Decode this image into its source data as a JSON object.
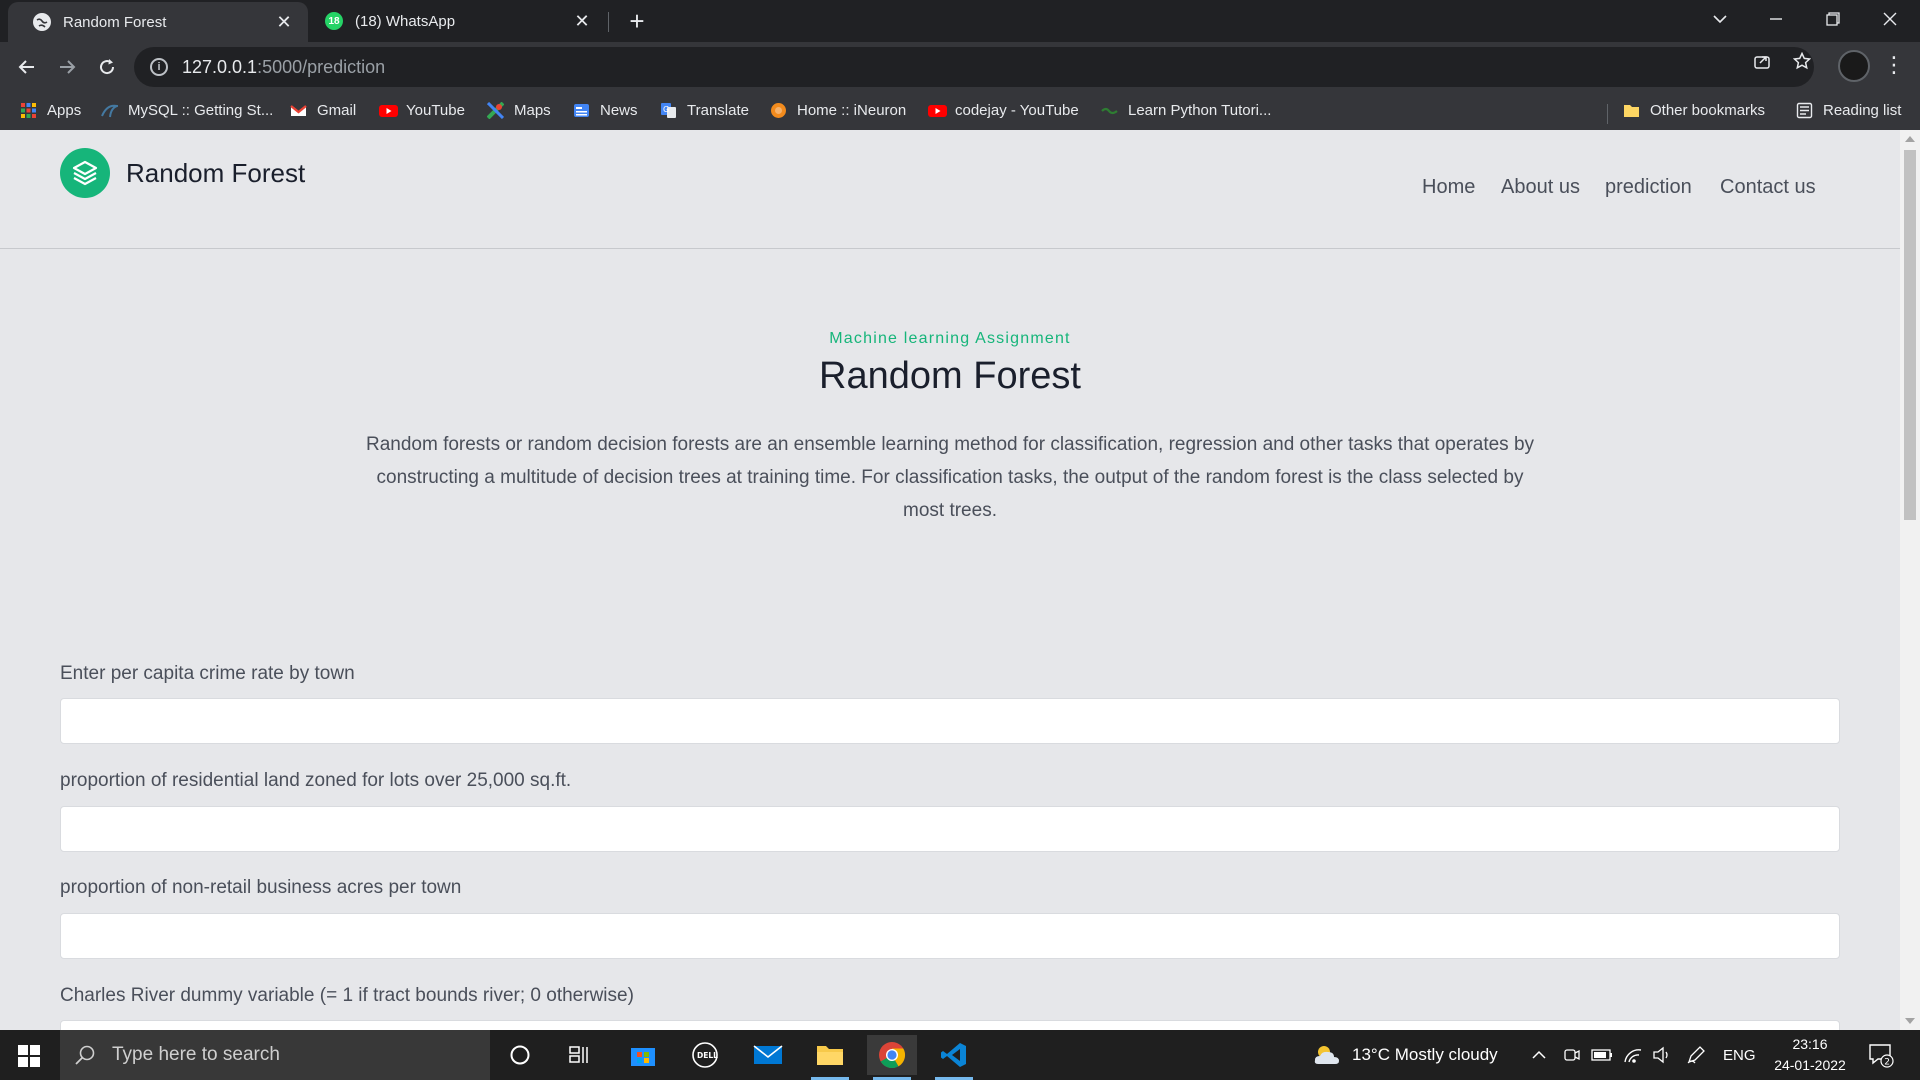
{
  "browser": {
    "tabs": [
      {
        "title": "Random Forest",
        "active": true
      },
      {
        "title": "(18) WhatsApp",
        "active": false,
        "badge": "18"
      }
    ],
    "address": {
      "host": "127.0.0.1",
      "path": ":5000/prediction"
    },
    "bookmarks": [
      {
        "label": "Apps",
        "icon": "apps-grid-icon"
      },
      {
        "label": "MySQL :: Getting St...",
        "icon": "mysql-icon"
      },
      {
        "label": "Gmail",
        "icon": "gmail-icon"
      },
      {
        "label": "YouTube",
        "icon": "youtube-icon"
      },
      {
        "label": "Maps",
        "icon": "maps-icon"
      },
      {
        "label": "News",
        "icon": "news-icon"
      },
      {
        "label": "Translate",
        "icon": "translate-icon"
      },
      {
        "label": "Home :: iNeuron",
        "icon": "ineuron-icon"
      },
      {
        "label": "codejay - YouTube",
        "icon": "youtube-icon"
      },
      {
        "label": "Learn Python Tutori...",
        "icon": "python-icon"
      }
    ],
    "other_bookmarks": "Other bookmarks",
    "reading_list": "Reading list"
  },
  "site": {
    "brand": "Random Forest",
    "nav": [
      "Home",
      "About us",
      "prediction",
      "Contact us"
    ],
    "hero": {
      "subtitle": "Machine learning Assignment",
      "title": "Random Forest",
      "description": "Random forests or random decision forests are an ensemble learning method for classification, regression and other tasks that operates by constructing a multitude of decision trees at training time. For classification tasks, the output of the random forest is the class selected by most trees."
    },
    "form": {
      "fields": [
        {
          "label": "Enter per capita crime rate by town",
          "value": ""
        },
        {
          "label": "proportion of residential land zoned for lots over 25,000 sq.ft.",
          "value": ""
        },
        {
          "label": "proportion of non-retail business acres per town",
          "value": ""
        },
        {
          "label": "Charles River dummy variable (= 1 if tract bounds river; 0 otherwise)",
          "value": ""
        }
      ]
    }
  },
  "taskbar": {
    "search_placeholder": "Type here to search",
    "weather": "13°C  Mostly cloudy",
    "language": "ENG",
    "time": "23:16",
    "date": "24-01-2022",
    "notifications": "2"
  },
  "colors": {
    "accent": "#16b57a",
    "page_bg": "#e6e7ea",
    "chrome_dark": "#202124",
    "chrome_toolbar": "#35363a"
  }
}
